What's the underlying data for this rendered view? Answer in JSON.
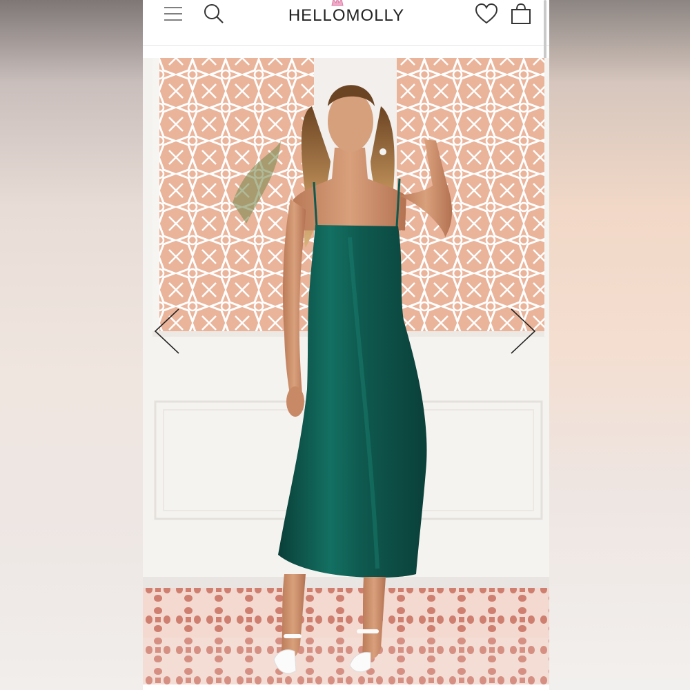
{
  "app": {
    "brand_name": "HELLOMOLLY"
  },
  "header": {
    "icons": [
      "menu-icon",
      "search-icon",
      "heart-icon",
      "bag-icon"
    ]
  },
  "product_gallery": {
    "image_description_icon": "product-photo",
    "nav": [
      "chevron-left-icon",
      "chevron-right-icon"
    ]
  },
  "colors": {
    "dress": "#0f5a50",
    "wall": "#f4f2ef",
    "lattice_bg": "#e9b29a",
    "tile": "#c77a6c"
  }
}
